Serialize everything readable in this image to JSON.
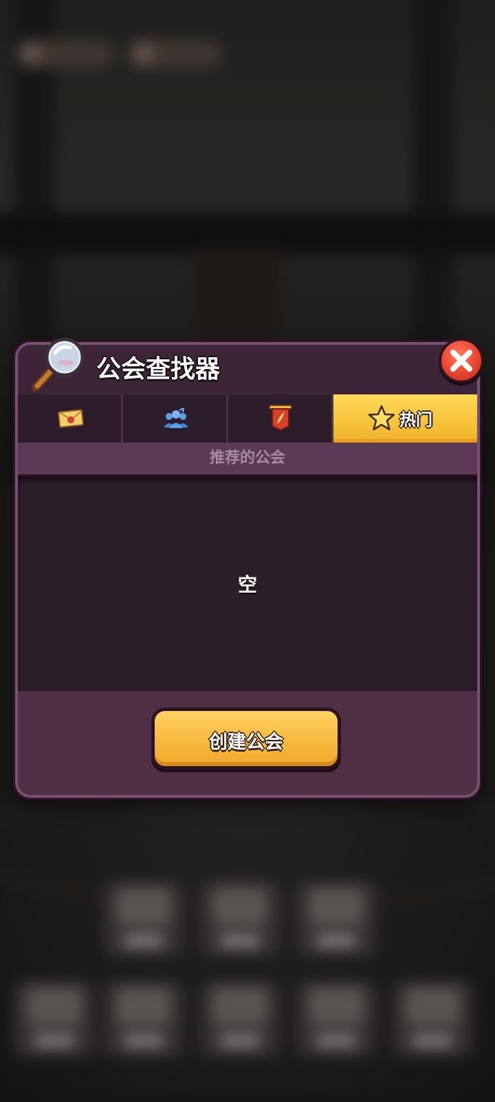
{
  "dialog": {
    "title": "公会查找器",
    "close_icon": "close-x-icon"
  },
  "tabs": [
    {
      "id": "invitations",
      "icon": "sealed-letter-icon",
      "label": "",
      "active": false
    },
    {
      "id": "members",
      "icon": "group-people-icon",
      "label": "",
      "active": false
    },
    {
      "id": "banner",
      "icon": "guild-banner-icon",
      "label": "",
      "active": false
    },
    {
      "id": "popular",
      "icon": "star-icon",
      "label": "热门",
      "active": true
    }
  ],
  "section": {
    "header": "推荐的公会",
    "empty_text": "空"
  },
  "footer": {
    "create_button_label": "创建公会"
  },
  "colors": {
    "dialog_bg": "#4f2f46",
    "active_tab": "#f6c23a",
    "button": "#f7b93e",
    "close_button": "#e8452e"
  }
}
